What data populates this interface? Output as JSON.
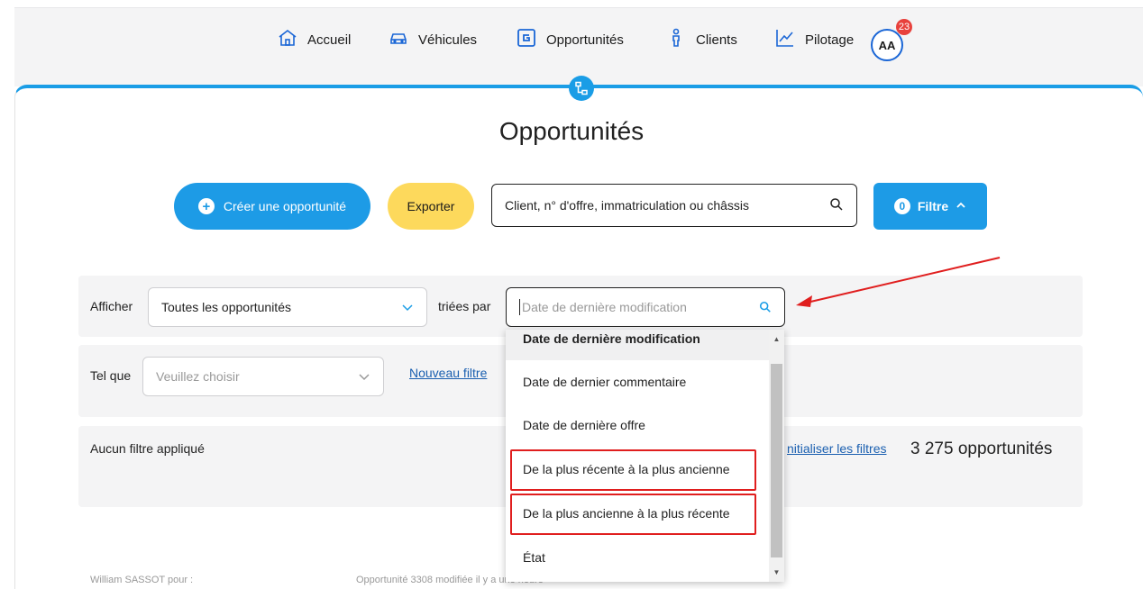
{
  "nav": {
    "items": [
      {
        "label": "Accueil",
        "icon": "home-icon"
      },
      {
        "label": "Véhicules",
        "icon": "car-icon"
      },
      {
        "label": "Opportunités",
        "icon": "opportunity-icon"
      },
      {
        "label": "Clients",
        "icon": "client-icon"
      },
      {
        "label": "Pilotage",
        "icon": "chart-icon"
      }
    ],
    "avatar_initials": "AA",
    "notification_count": "23"
  },
  "page": {
    "title": "Opportunités",
    "create_label": "Créer une opportunité",
    "export_label": "Exporter",
    "search_placeholder": "Client, n° d'offre, immatriculation ou châssis",
    "filter_count": "0",
    "filter_label": "Filtre"
  },
  "filters": {
    "show_label": "Afficher",
    "show_value": "Toutes les opportunités",
    "sorted_by_label": "triées par",
    "sort_placeholder": "Date de dernière modification",
    "condition_label": "Tel que",
    "condition_placeholder": "Veuillez choisir",
    "new_filter_label": "Nouveau filtre",
    "no_filter_label": "Aucun filtre appliqué",
    "reset_label": "nitialiser les filtres",
    "count_label": "3 275 opportunités"
  },
  "dropdown": {
    "items": [
      "Date de dernière modification",
      "Date de dernier commentaire",
      "Date de dernière offre",
      "De la plus récente à la plus ancienne",
      "De la plus ancienne à la plus récente",
      "État"
    ]
  },
  "footer": {
    "left": "William SASSOT pour :",
    "middle": "Opportunité 3308 modifiée il y a une heure"
  },
  "colors": {
    "primary": "#1d9be6",
    "export": "#fdd95c",
    "annotation": "#e01e1e",
    "badge": "#e8413c"
  }
}
